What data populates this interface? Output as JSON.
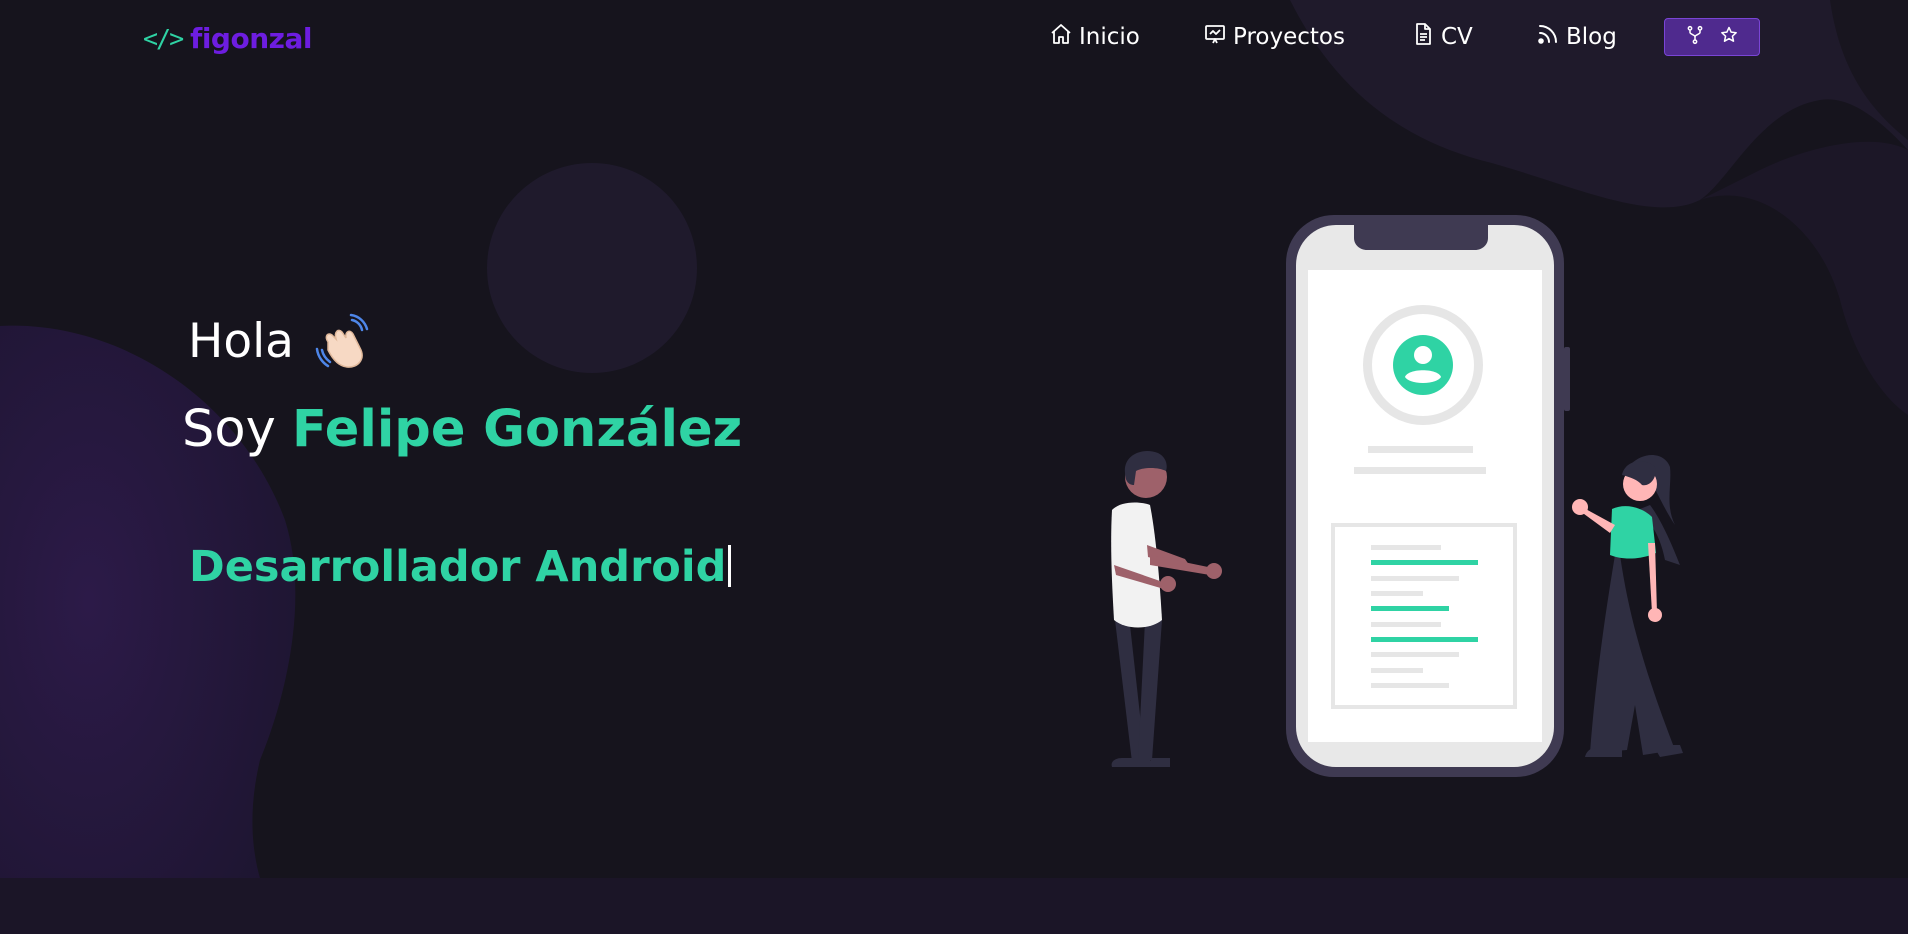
{
  "brand": {
    "code_icon": "</>",
    "name": "figonzal"
  },
  "nav": {
    "items": [
      {
        "label": "Inicio",
        "icon": "home-icon"
      },
      {
        "label": "Proyectos",
        "icon": "presentation-icon"
      },
      {
        "label": "CV",
        "icon": "document-icon"
      },
      {
        "label": "Blog",
        "icon": "rss-icon"
      }
    ],
    "github_buttons": [
      "fork-icon",
      "star-icon"
    ]
  },
  "hero": {
    "greeting": "Hola",
    "greeting_emoji": "waving-hand-icon",
    "intro_prefix": "Soy",
    "intro_name": "Felipe González",
    "typed_role": "Desarrollador Android"
  },
  "colors": {
    "background": "#16141d",
    "accent_green": "#2fd3a4",
    "brand_purple": "#6d1de0",
    "button_purple": "#4f2a8e",
    "blob_purple": "#2b1a45"
  }
}
